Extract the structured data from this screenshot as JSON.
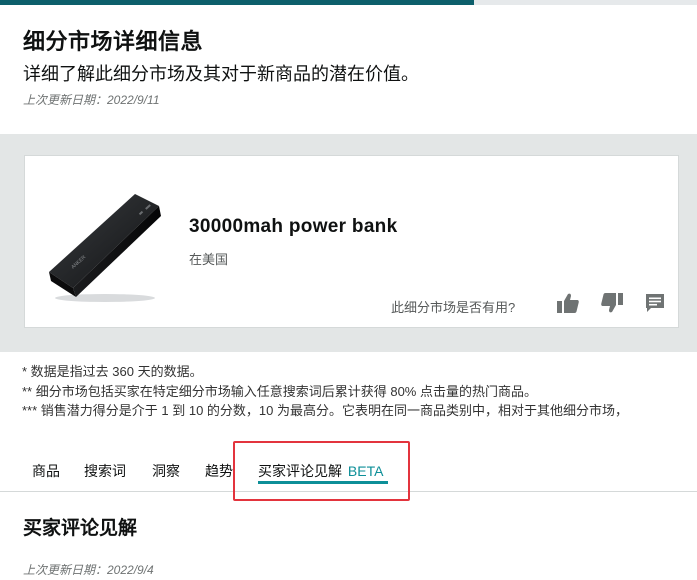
{
  "progress": {
    "fraction": 0.68
  },
  "header": {
    "title": "细分市场详细信息",
    "subtitle": "详细了解此细分市场及其对于新商品的潜在价值。",
    "updated": "上次更新日期：2022/9/11"
  },
  "product": {
    "name": "30000mah power bank",
    "location": "在美国",
    "helpful_question": "此细分市场是否有用?",
    "icons": [
      "thumbs-up-icon",
      "thumbs-down-icon",
      "comment-icon"
    ]
  },
  "notes": [
    "* 数据是指过去 360 天的数据。",
    "** 细分市场包括买家在特定细分市场输入任意搜索词后累计获得 80% 点击量的热门商品。",
    "*** 销售潜力得分是介于 1 到 10 的分数，10 为最高分。它表明在同一商品类别中，相对于其他细分市场，"
  ],
  "tabs": [
    {
      "label": "商品"
    },
    {
      "label": "搜索词"
    },
    {
      "label": "洞察"
    },
    {
      "label": "趋势"
    },
    {
      "label": "买家评论见解",
      "badge": "BETA",
      "active": true
    }
  ],
  "section": {
    "title": "买家评论见解",
    "updated": "上次更新日期：2022/9/4"
  },
  "colors": {
    "accent": "#0d8f98",
    "progress": "#0d5f6b",
    "highlight": "#e3343d",
    "band": "#e3e6e6"
  }
}
